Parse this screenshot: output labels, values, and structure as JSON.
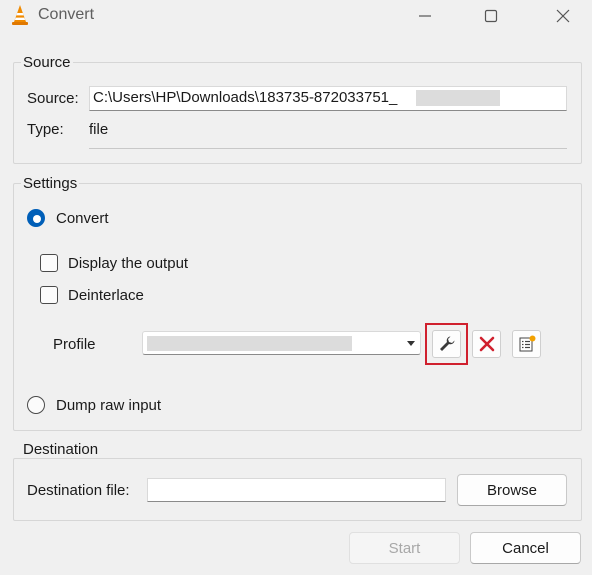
{
  "window": {
    "title": "Convert",
    "icons": [
      "vlc-cone-icon",
      "minimize-icon",
      "maximize-icon",
      "close-icon"
    ]
  },
  "source": {
    "group_title": "Source",
    "source_label": "Source:",
    "source_value": "C:\\Users\\HP\\Downloads\\183735-872033751_",
    "type_label": "Type:",
    "type_value": "file"
  },
  "settings": {
    "group_title": "Settings",
    "convert_label": "Convert",
    "display_output_label": "Display the output",
    "deinterlace_label": "Deinterlace",
    "profile_label": "Profile",
    "dump_raw_label": "Dump raw input",
    "profile_buttons": [
      "wrench-icon",
      "delete-x-icon",
      "new-profile-icon"
    ]
  },
  "destination": {
    "group_title": "Destination",
    "dest_label": "Destination file:",
    "dest_value": "",
    "browse_label": "Browse"
  },
  "footer": {
    "start_label": "Start",
    "cancel_label": "Cancel"
  },
  "colors": {
    "accent": "#005fb8",
    "highlight": "#d0202e",
    "delete": "#d0202e",
    "vlc_orange": "#f08a00"
  }
}
